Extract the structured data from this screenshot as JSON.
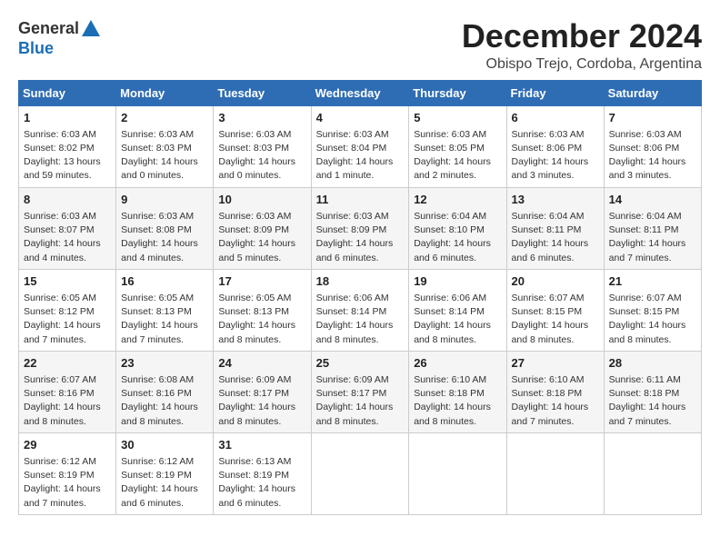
{
  "logo": {
    "general": "General",
    "blue": "Blue"
  },
  "title": "December 2024",
  "subtitle": "Obispo Trejo, Cordoba, Argentina",
  "headers": [
    "Sunday",
    "Monday",
    "Tuesday",
    "Wednesday",
    "Thursday",
    "Friday",
    "Saturday"
  ],
  "weeks": [
    [
      {
        "day": "1",
        "sunrise": "6:03 AM",
        "sunset": "8:02 PM",
        "daylight": "13 hours and 59 minutes."
      },
      {
        "day": "2",
        "sunrise": "6:03 AM",
        "sunset": "8:03 PM",
        "daylight": "14 hours and 0 minutes."
      },
      {
        "day": "3",
        "sunrise": "6:03 AM",
        "sunset": "8:03 PM",
        "daylight": "14 hours and 0 minutes."
      },
      {
        "day": "4",
        "sunrise": "6:03 AM",
        "sunset": "8:04 PM",
        "daylight": "14 hours and 1 minute."
      },
      {
        "day": "5",
        "sunrise": "6:03 AM",
        "sunset": "8:05 PM",
        "daylight": "14 hours and 2 minutes."
      },
      {
        "day": "6",
        "sunrise": "6:03 AM",
        "sunset": "8:06 PM",
        "daylight": "14 hours and 3 minutes."
      },
      {
        "day": "7",
        "sunrise": "6:03 AM",
        "sunset": "8:06 PM",
        "daylight": "14 hours and 3 minutes."
      }
    ],
    [
      {
        "day": "8",
        "sunrise": "6:03 AM",
        "sunset": "8:07 PM",
        "daylight": "14 hours and 4 minutes."
      },
      {
        "day": "9",
        "sunrise": "6:03 AM",
        "sunset": "8:08 PM",
        "daylight": "14 hours and 4 minutes."
      },
      {
        "day": "10",
        "sunrise": "6:03 AM",
        "sunset": "8:09 PM",
        "daylight": "14 hours and 5 minutes."
      },
      {
        "day": "11",
        "sunrise": "6:03 AM",
        "sunset": "8:09 PM",
        "daylight": "14 hours and 6 minutes."
      },
      {
        "day": "12",
        "sunrise": "6:04 AM",
        "sunset": "8:10 PM",
        "daylight": "14 hours and 6 minutes."
      },
      {
        "day": "13",
        "sunrise": "6:04 AM",
        "sunset": "8:11 PM",
        "daylight": "14 hours and 6 minutes."
      },
      {
        "day": "14",
        "sunrise": "6:04 AM",
        "sunset": "8:11 PM",
        "daylight": "14 hours and 7 minutes."
      }
    ],
    [
      {
        "day": "15",
        "sunrise": "6:05 AM",
        "sunset": "8:12 PM",
        "daylight": "14 hours and 7 minutes."
      },
      {
        "day": "16",
        "sunrise": "6:05 AM",
        "sunset": "8:13 PM",
        "daylight": "14 hours and 7 minutes."
      },
      {
        "day": "17",
        "sunrise": "6:05 AM",
        "sunset": "8:13 PM",
        "daylight": "14 hours and 8 minutes."
      },
      {
        "day": "18",
        "sunrise": "6:06 AM",
        "sunset": "8:14 PM",
        "daylight": "14 hours and 8 minutes."
      },
      {
        "day": "19",
        "sunrise": "6:06 AM",
        "sunset": "8:14 PM",
        "daylight": "14 hours and 8 minutes."
      },
      {
        "day": "20",
        "sunrise": "6:07 AM",
        "sunset": "8:15 PM",
        "daylight": "14 hours and 8 minutes."
      },
      {
        "day": "21",
        "sunrise": "6:07 AM",
        "sunset": "8:15 PM",
        "daylight": "14 hours and 8 minutes."
      }
    ],
    [
      {
        "day": "22",
        "sunrise": "6:07 AM",
        "sunset": "8:16 PM",
        "daylight": "14 hours and 8 minutes."
      },
      {
        "day": "23",
        "sunrise": "6:08 AM",
        "sunset": "8:16 PM",
        "daylight": "14 hours and 8 minutes."
      },
      {
        "day": "24",
        "sunrise": "6:09 AM",
        "sunset": "8:17 PM",
        "daylight": "14 hours and 8 minutes."
      },
      {
        "day": "25",
        "sunrise": "6:09 AM",
        "sunset": "8:17 PM",
        "daylight": "14 hours and 8 minutes."
      },
      {
        "day": "26",
        "sunrise": "6:10 AM",
        "sunset": "8:18 PM",
        "daylight": "14 hours and 8 minutes."
      },
      {
        "day": "27",
        "sunrise": "6:10 AM",
        "sunset": "8:18 PM",
        "daylight": "14 hours and 7 minutes."
      },
      {
        "day": "28",
        "sunrise": "6:11 AM",
        "sunset": "8:18 PM",
        "daylight": "14 hours and 7 minutes."
      }
    ],
    [
      {
        "day": "29",
        "sunrise": "6:12 AM",
        "sunset": "8:19 PM",
        "daylight": "14 hours and 7 minutes."
      },
      {
        "day": "30",
        "sunrise": "6:12 AM",
        "sunset": "8:19 PM",
        "daylight": "14 hours and 6 minutes."
      },
      {
        "day": "31",
        "sunrise": "6:13 AM",
        "sunset": "8:19 PM",
        "daylight": "14 hours and 6 minutes."
      },
      null,
      null,
      null,
      null
    ]
  ],
  "labels": {
    "sunrise": "Sunrise:",
    "sunset": "Sunset:",
    "daylight": "Daylight:"
  }
}
